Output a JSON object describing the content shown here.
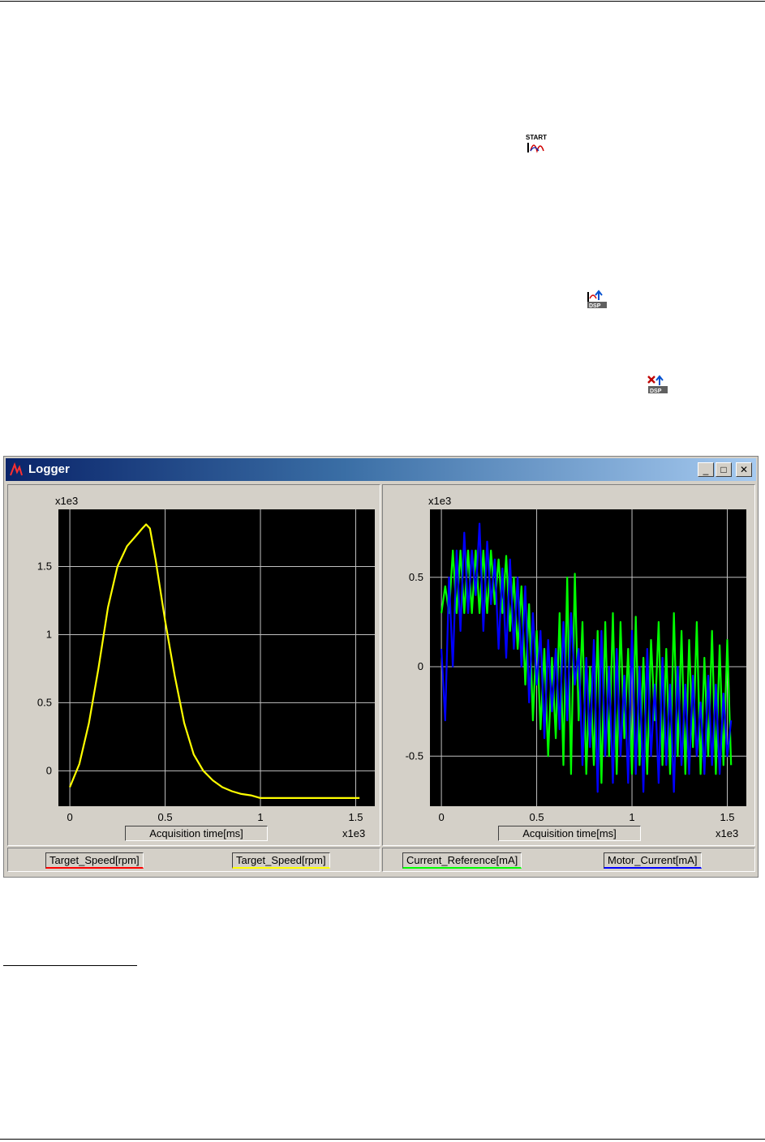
{
  "window": {
    "title": "Logger"
  },
  "controls": {
    "minimize": "_",
    "maximize": "□",
    "close": "✕"
  },
  "icons": {
    "start": "start-logger-icon",
    "upload": "upload-dsp-icon",
    "delete": "delete-dsp-icon"
  },
  "left_chart": {
    "exponent_label": "x1e3",
    "x_exponent_label": "x1e3",
    "xlabel": "Acquisition time[ms]",
    "y_ticks": [
      "0",
      "0.5",
      "1",
      "1.5"
    ],
    "x_ticks": [
      "0",
      "0.5",
      "1",
      "1.5"
    ]
  },
  "right_chart": {
    "exponent_label": "x1e3",
    "x_exponent_label": "x1e3",
    "xlabel": "Acquisition time[ms]",
    "y_ticks": [
      "-0.5",
      "0",
      "0.5"
    ],
    "x_ticks": [
      "0",
      "0.5",
      "1",
      "1.5"
    ]
  },
  "legend": {
    "left": [
      {
        "label": "Target_Speed[rpm]",
        "color": "#ff0000"
      },
      {
        "label": "Target_Speed[rpm]",
        "color": "#ffff00"
      }
    ],
    "right": [
      {
        "label": "Current_Reference[mA]",
        "color": "#00ff00"
      },
      {
        "label": "Motor_Current[mA]",
        "color": "#0000ff"
      }
    ]
  },
  "chart_data": [
    {
      "type": "line",
      "xlabel": "Acquisition time[ms]",
      "ylabel": "",
      "xlim": [
        -0.06,
        1.6
      ],
      "ylim": [
        -0.26,
        1.92
      ],
      "scale_note": "x1e3",
      "series": [
        {
          "name": "Target_Speed[rpm]",
          "color": "#ffff00",
          "x": [
            0,
            0.05,
            0.1,
            0.15,
            0.2,
            0.25,
            0.3,
            0.35,
            0.38,
            0.4,
            0.42,
            0.45,
            0.5,
            0.55,
            0.6,
            0.65,
            0.7,
            0.75,
            0.8,
            0.85,
            0.9,
            0.95,
            1.0,
            1.1,
            1.2,
            1.3,
            1.4,
            1.52
          ],
          "y": [
            -0.12,
            0.05,
            0.35,
            0.75,
            1.2,
            1.5,
            1.65,
            1.73,
            1.78,
            1.81,
            1.78,
            1.55,
            1.1,
            0.7,
            0.35,
            0.12,
            0.0,
            -0.07,
            -0.12,
            -0.15,
            -0.17,
            -0.18,
            -0.2,
            -0.2,
            -0.2,
            -0.2,
            -0.2,
            -0.2
          ]
        }
      ]
    },
    {
      "type": "line",
      "xlabel": "Acquisition time[ms]",
      "ylabel": "",
      "xlim": [
        -0.06,
        1.6
      ],
      "ylim": [
        -0.78,
        0.88
      ],
      "scale_note": "x1e3",
      "series": [
        {
          "name": "Current_Reference[mA]",
          "color": "#00ff00",
          "x": [
            0,
            0.02,
            0.04,
            0.06,
            0.08,
            0.1,
            0.12,
            0.14,
            0.16,
            0.18,
            0.2,
            0.22,
            0.24,
            0.26,
            0.28,
            0.3,
            0.32,
            0.34,
            0.36,
            0.38,
            0.4,
            0.42,
            0.44,
            0.46,
            0.48,
            0.5,
            0.52,
            0.54,
            0.56,
            0.58,
            0.6,
            0.62,
            0.64,
            0.66,
            0.68,
            0.7,
            0.72,
            0.74,
            0.76,
            0.78,
            0.8,
            0.82,
            0.84,
            0.86,
            0.88,
            0.9,
            0.92,
            0.94,
            0.96,
            0.98,
            1.0,
            1.02,
            1.04,
            1.06,
            1.08,
            1.1,
            1.12,
            1.14,
            1.16,
            1.18,
            1.2,
            1.22,
            1.24,
            1.26,
            1.28,
            1.3,
            1.32,
            1.34,
            1.36,
            1.38,
            1.4,
            1.42,
            1.44,
            1.46,
            1.48,
            1.5,
            1.52
          ],
          "y": [
            0.3,
            0.45,
            0.3,
            0.65,
            0.3,
            0.65,
            0.3,
            0.65,
            0.3,
            0.65,
            0.3,
            0.65,
            0.3,
            0.65,
            0.35,
            0.6,
            0.3,
            0.62,
            0.2,
            0.5,
            0.1,
            0.45,
            -0.1,
            0.35,
            -0.3,
            0.2,
            -0.35,
            0.1,
            -0.5,
            0.05,
            -0.4,
            0.3,
            -0.55,
            0.5,
            -0.6,
            0.52,
            -0.3,
            0.25,
            -0.6,
            0.0,
            -0.55,
            0.2,
            -0.65,
            0.25,
            -0.5,
            0.3,
            -0.6,
            0.25,
            -0.4,
            0.1,
            -0.6,
            0.28,
            -0.55,
            0.05,
            -0.6,
            0.15,
            -0.3,
            0.25,
            -0.55,
            0.1,
            -0.6,
            0.3,
            -0.5,
            0.2,
            -0.6,
            0.15,
            -0.45,
            0.25,
            -0.6,
            0.05,
            -0.5,
            0.2,
            -0.6,
            0.12,
            -0.55,
            0.15,
            -0.55
          ]
        },
        {
          "name": "Motor_Current[mA]",
          "color": "#0000ff",
          "x": [
            0,
            0.02,
            0.04,
            0.06,
            0.08,
            0.1,
            0.12,
            0.14,
            0.16,
            0.18,
            0.2,
            0.22,
            0.24,
            0.26,
            0.28,
            0.3,
            0.32,
            0.34,
            0.36,
            0.38,
            0.4,
            0.42,
            0.44,
            0.46,
            0.48,
            0.5,
            0.52,
            0.54,
            0.56,
            0.58,
            0.6,
            0.62,
            0.64,
            0.66,
            0.68,
            0.7,
            0.72,
            0.74,
            0.76,
            0.78,
            0.8,
            0.82,
            0.84,
            0.86,
            0.88,
            0.9,
            0.92,
            0.94,
            0.96,
            0.98,
            1.0,
            1.02,
            1.04,
            1.06,
            1.08,
            1.1,
            1.12,
            1.14,
            1.16,
            1.18,
            1.2,
            1.22,
            1.24,
            1.26,
            1.28,
            1.3,
            1.32,
            1.34,
            1.36,
            1.38,
            1.4,
            1.42,
            1.44,
            1.46,
            1.48,
            1.5,
            1.52
          ],
          "y": [
            0.1,
            -0.3,
            0.5,
            0.0,
            0.65,
            0.2,
            0.75,
            0.3,
            0.65,
            0.4,
            0.8,
            0.2,
            0.7,
            0.35,
            0.6,
            0.1,
            0.55,
            0.05,
            0.6,
            0.1,
            0.5,
            0.0,
            0.45,
            -0.2,
            0.3,
            -0.1,
            0.2,
            -0.4,
            0.15,
            -0.25,
            0.1,
            -0.35,
            0.25,
            -0.3,
            0.3,
            -0.1,
            0.1,
            -0.55,
            0.05,
            -0.45,
            0.15,
            -0.7,
            0.2,
            -0.5,
            0.0,
            -0.65,
            0.1,
            -0.5,
            -0.05,
            -0.65,
            0.2,
            -0.6,
            0.0,
            -0.7,
            0.1,
            -0.5,
            -0.1,
            -0.65,
            0.05,
            -0.55,
            -0.1,
            -0.7,
            0.0,
            -0.55,
            -0.1,
            -0.6,
            -0.05,
            -0.5,
            -0.2,
            -0.6,
            -0.05,
            -0.55,
            -0.1,
            -0.6,
            -0.15,
            -0.5,
            -0.3
          ]
        }
      ]
    }
  ]
}
